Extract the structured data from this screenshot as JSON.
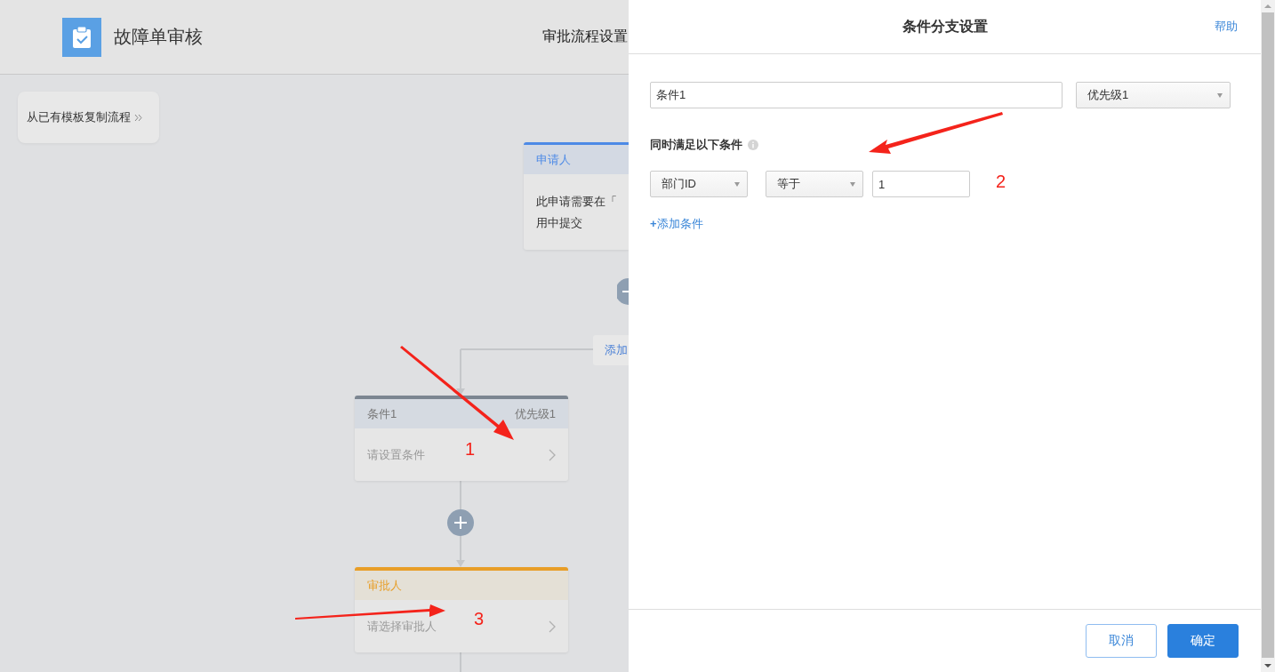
{
  "header": {
    "title": "故障单审核",
    "tab": "审批流程设置"
  },
  "copy_button": "从已有模板复制流程",
  "nodes": [
    {
      "kind": "applicant",
      "title": "申请人",
      "lines": [
        "此申请需要在「",
        "用中提交"
      ]
    },
    {
      "kind": "condition",
      "title": "条件1",
      "priority": "优先级1",
      "body": "请设置条件"
    },
    {
      "kind": "approver",
      "title": "审批人",
      "body": "请选择审批人"
    }
  ],
  "add_branch": "添加",
  "panel": {
    "title": "条件分支设置",
    "help": "帮助",
    "name_value": "条件1",
    "priority": "优先级1",
    "section": "同时满足以下条件",
    "conditions": [
      {
        "field": "部门ID",
        "operator": "等于",
        "value": "1"
      }
    ],
    "add_condition": "**+**添加条件",
    "buttons": [
      {
        "label": "取消",
        "primary": false
      },
      {
        "label": "确定",
        "primary": true
      }
    ]
  },
  "annotations": [
    "1",
    "2",
    "3"
  ]
}
